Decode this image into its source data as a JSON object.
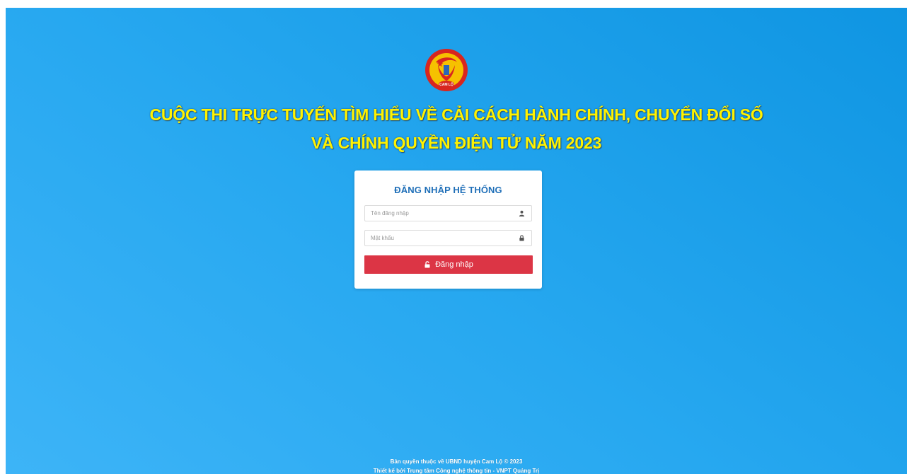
{
  "logo": {
    "text": "CAM LỘ",
    "icon": "cam-lo-emblem",
    "colors": {
      "ring": "#d8261f",
      "inner": "#f6c100"
    }
  },
  "header": {
    "title_line_1": "CUỘC THI TRỰC TUYẾN TÌM HIỂU VỀ CẢI CÁCH HÀNH CHÍNH, CHUYỂN ĐỔI SỐ",
    "title_line_2": "VÀ CHÍNH QUYỀN ĐIỆN TỬ NĂM 2023",
    "title_color": "#fff200"
  },
  "login": {
    "title": "ĐĂNG NHẬP HỆ THỐNG",
    "username": {
      "value": "",
      "placeholder": "Tên đăng nhập",
      "icon": "user-icon"
    },
    "password": {
      "value": "",
      "placeholder": "Mật khẩu",
      "icon": "lock-icon"
    },
    "submit_label": "Đăng nhập",
    "submit_icon": "unlock-icon",
    "accent_color": "#dc3545",
    "title_color": "#1f6fb8"
  },
  "footer": {
    "line_1": "Bản quyền thuộc về UBND huyện Cam Lộ © 2023",
    "line_2": "Thiết kế bởi Trung tâm Công nghệ thông tin - VNPT Quảng Trị"
  },
  "colors": {
    "background_start": "#3db4f7",
    "background_end": "#0f95e2"
  }
}
